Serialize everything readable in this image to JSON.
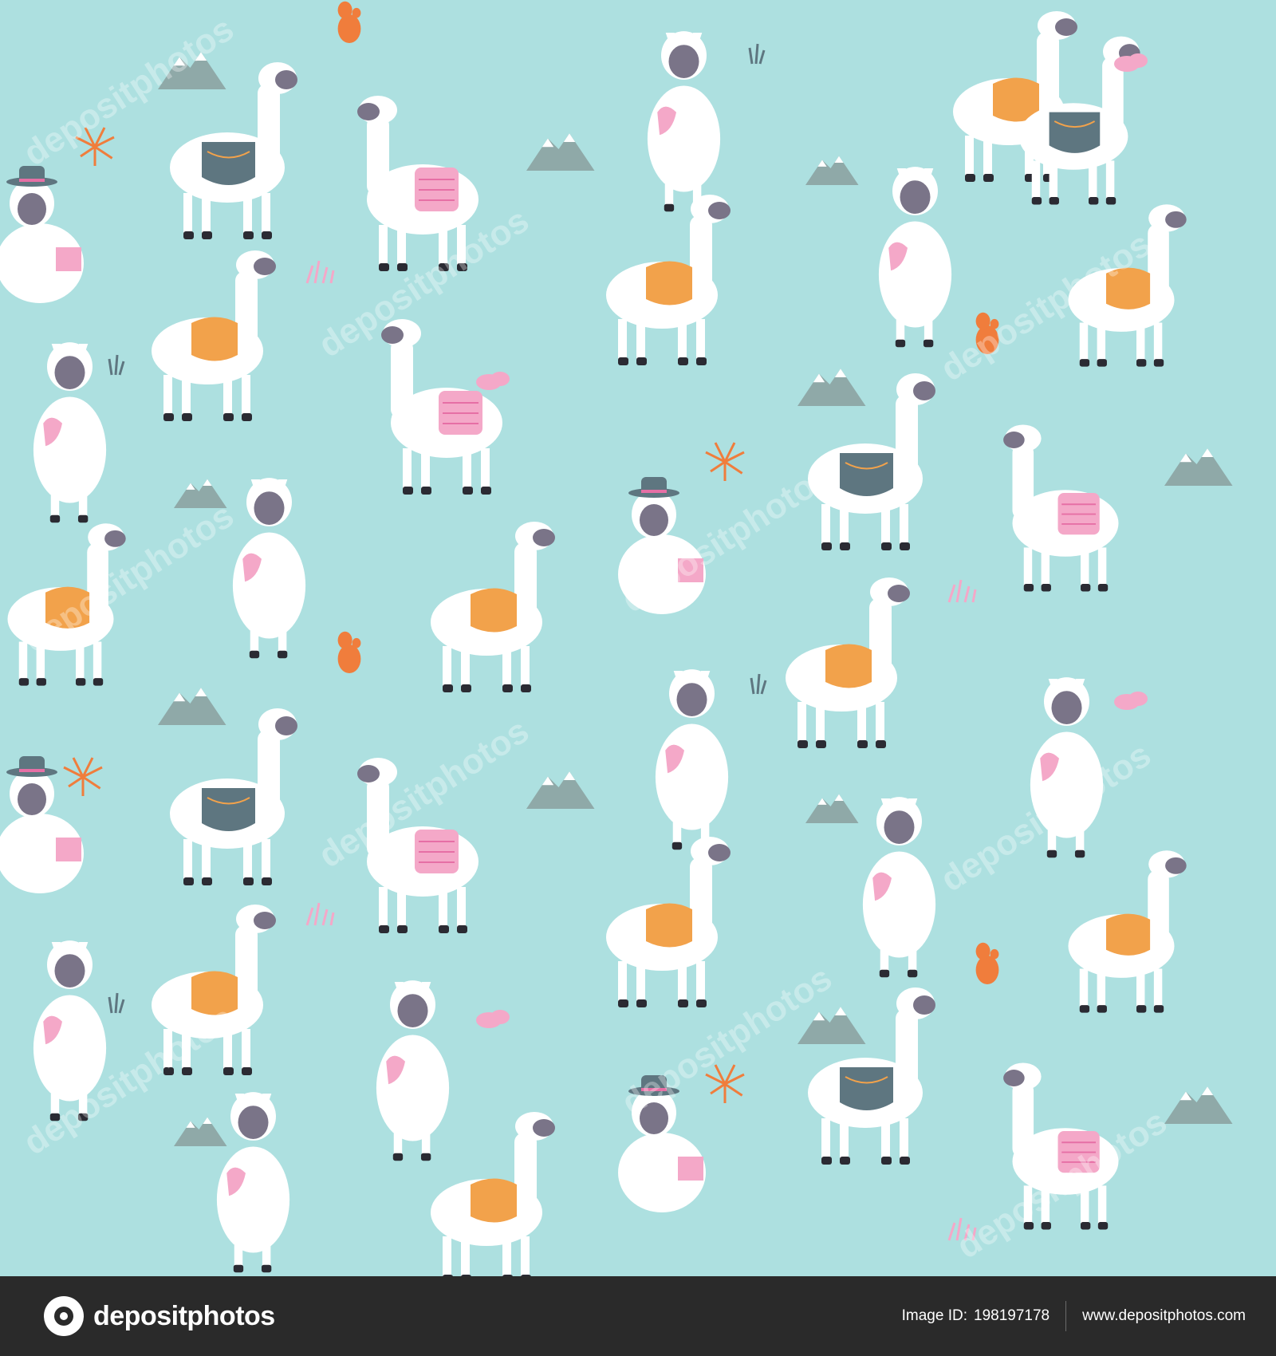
{
  "footer": {
    "brand": "depositphotos",
    "image_id_label": "Image ID:",
    "image_id": "198197178",
    "website": "www.depositphotos.com"
  },
  "watermark_text": "depositphotos",
  "colors": {
    "background": "#ADE0E0",
    "footer": "#2A2A2A",
    "fleece": "#FFFFFF",
    "face": "#7A7488",
    "blanket_orange": "#F2A24B",
    "blanket_slate": "#5E7680",
    "blanket_pink": "#F4A8C8",
    "mountain": "#8FA9A8",
    "cactus": "#F07D3C"
  }
}
